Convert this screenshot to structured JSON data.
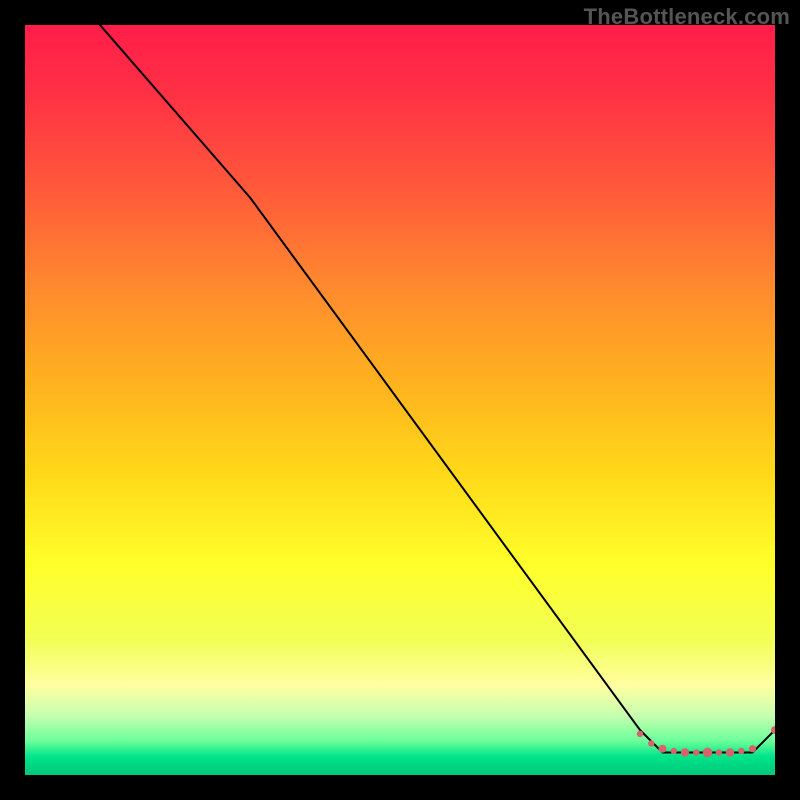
{
  "watermark": "TheBottleneck.com",
  "gradient": {
    "stops": [
      {
        "offset": 0.0,
        "color": "#ff1d4a"
      },
      {
        "offset": 0.1,
        "color": "#ff3344"
      },
      {
        "offset": 0.22,
        "color": "#ff5a3a"
      },
      {
        "offset": 0.35,
        "color": "#ff8a2e"
      },
      {
        "offset": 0.48,
        "color": "#ffb31e"
      },
      {
        "offset": 0.6,
        "color": "#ffd91a"
      },
      {
        "offset": 0.72,
        "color": "#ffff2a"
      },
      {
        "offset": 0.82,
        "color": "#f1ff55"
      },
      {
        "offset": 0.88,
        "color": "#ffffa0"
      },
      {
        "offset": 0.92,
        "color": "#c8ffb0"
      },
      {
        "offset": 0.955,
        "color": "#6bff9a"
      },
      {
        "offset": 0.975,
        "color": "#00e58a"
      },
      {
        "offset": 1.0,
        "color": "#00c87a"
      }
    ]
  },
  "chart_data": {
    "type": "line",
    "title": "",
    "xlabel": "",
    "ylabel": "",
    "xlim": [
      0,
      100
    ],
    "ylim": [
      0,
      100
    ],
    "series": [
      {
        "name": "bottleneck-curve",
        "x": [
          10,
          30,
          82,
          85,
          97,
          100
        ],
        "y": [
          100,
          77,
          6,
          3,
          3,
          6
        ]
      }
    ],
    "markers": {
      "name": "bottom-points",
      "color": "#d9636b",
      "points": [
        {
          "x": 82.0,
          "y": 5.5,
          "r": 3.2
        },
        {
          "x": 83.5,
          "y": 4.2,
          "r": 3.2
        },
        {
          "x": 85.0,
          "y": 3.5,
          "r": 4.0
        },
        {
          "x": 86.5,
          "y": 3.2,
          "r": 3.2
        },
        {
          "x": 88.0,
          "y": 3.0,
          "r": 4.2
        },
        {
          "x": 89.5,
          "y": 3.0,
          "r": 3.2
        },
        {
          "x": 91.0,
          "y": 3.0,
          "r": 4.8
        },
        {
          "x": 92.5,
          "y": 3.0,
          "r": 3.2
        },
        {
          "x": 94.0,
          "y": 3.0,
          "r": 4.2
        },
        {
          "x": 95.5,
          "y": 3.2,
          "r": 3.2
        },
        {
          "x": 97.0,
          "y": 3.5,
          "r": 3.6
        },
        {
          "x": 100.0,
          "y": 6.0,
          "r": 4.0
        }
      ]
    }
  }
}
